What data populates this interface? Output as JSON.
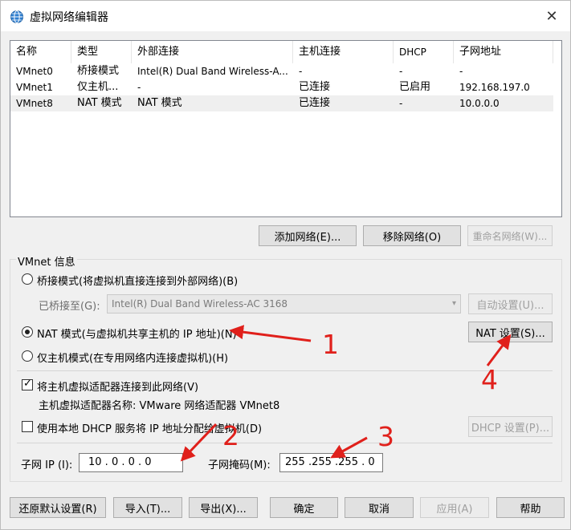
{
  "window": {
    "title": "虚拟网络编辑器",
    "close_glyph": "✕"
  },
  "table": {
    "columns": [
      "名称",
      "类型",
      "外部连接",
      "主机连接",
      "DHCP",
      "子网地址"
    ],
    "rows": [
      [
        "VMnet0",
        "桥接模式",
        "Intel(R) Dual Band Wireless-A...",
        "-",
        "-",
        "-"
      ],
      [
        "VMnet1",
        "仅主机...",
        "-",
        "已连接",
        "已启用",
        "192.168.197.0"
      ],
      [
        "VMnet8",
        "NAT 模式",
        "NAT 模式",
        "已连接",
        "-",
        "10.0.0.0"
      ]
    ],
    "selected_row": 2
  },
  "table_buttons": {
    "add": "添加网络(E)...",
    "remove": "移除网络(O)",
    "rename": "重命名网络(W)..."
  },
  "vmnet_info": {
    "group_label": "VMnet 信息",
    "bridge_radio": "桥接模式(将虚拟机直接连接到外部网络)(B)",
    "bridged_to_label": "已桥接至(G):",
    "bridged_to_value": "Intel(R) Dual Band Wireless-AC 3168",
    "auto_settings": "自动设置(U)...",
    "nat_radio": "NAT 模式(与虚拟机共享主机的 IP 地址)(N)",
    "nat_settings": "NAT 设置(S)...",
    "hostonly_radio": "仅主机模式(在专用网络内连接虚拟机)(H)",
    "connect_adapter_check": "将主机虚拟适配器连接到此网络(V)",
    "adapter_name": "主机虚拟适配器名称: VMware 网络适配器 VMnet8",
    "dhcp_check": "使用本地 DHCP 服务将 IP 地址分配给虚拟机(D)",
    "dhcp_settings": "DHCP 设置(P)...",
    "subnet_ip_label": "子网 IP (I):",
    "subnet_ip_value": "10 . 0 . 0 . 0",
    "subnet_mask_label": "子网掩码(M):",
    "subnet_mask_value": "255 .255 .255 . 0",
    "selected_mode": "nat",
    "connect_adapter_checked": true,
    "dhcp_checked": false
  },
  "bottom_buttons": {
    "restore": "还原默认设置(R)",
    "import": "导入(T)...",
    "export": "导出(X)...",
    "ok": "确定",
    "cancel": "取消",
    "apply": "应用(A)",
    "help": "帮助"
  },
  "annotations": {
    "n1": "1",
    "n2": "2",
    "n3": "3",
    "n4": "4",
    "color": "#e0201b"
  }
}
